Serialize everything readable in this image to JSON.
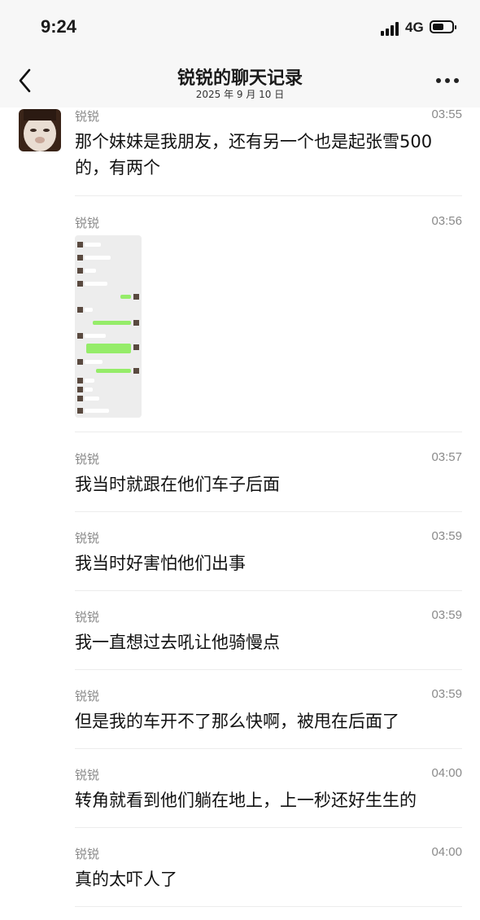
{
  "status_bar": {
    "time": "9:24",
    "network": "4G",
    "battery_level": 0.6
  },
  "nav": {
    "title": "锐锐的聊天记录",
    "subtitle": "2025 年 9 月 10 日",
    "back_icon": "chevron-left-icon",
    "more_icon": "more-dots-icon"
  },
  "messages": [
    {
      "sender": "锐锐",
      "time": "03:55",
      "text": "那个妹妹是我朋友，还有另一个也是起张雪500的，有两个"
    },
    {
      "sender": "锐锐",
      "time": "03:56",
      "image": "chat-screenshot-thumbnail"
    },
    {
      "sender": "锐锐",
      "time": "03:57",
      "text": "我当时就跟在他们车子后面"
    },
    {
      "sender": "锐锐",
      "time": "03:59",
      "text": "我当时好害怕他们出事"
    },
    {
      "sender": "锐锐",
      "time": "03:59",
      "text": "我一直想过去吼让他骑慢点"
    },
    {
      "sender": "锐锐",
      "time": "03:59",
      "text": "但是我的车开不了那么快啊，被甩在后面了"
    },
    {
      "sender": "锐锐",
      "time": "04:00",
      "text": "转角就看到他们躺在地上，上一秒还好生生的"
    },
    {
      "sender": "锐锐",
      "time": "04:00",
      "text": "真的太吓人了"
    }
  ],
  "colors": {
    "page_bg": "#f7f7f7",
    "content_bg": "#ffffff",
    "meta_text": "#8a8a8a",
    "bubble_green": "#95ec69"
  }
}
